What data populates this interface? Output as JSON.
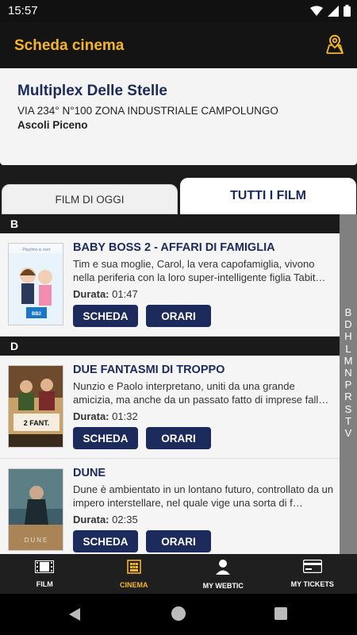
{
  "status": {
    "time": "15:57"
  },
  "appbar": {
    "title": "Scheda cinema"
  },
  "cinema": {
    "name": "Multiplex Delle Stelle",
    "address": "VIA 234° N°100 ZONA INDUSTRIALE CAMPOLUNGO",
    "city": "Ascoli Piceno"
  },
  "tabs": {
    "today": "FILM DI OGGI",
    "all": "TUTTI I FILM"
  },
  "sections": [
    {
      "letter": "B",
      "movies": [
        {
          "title": "BABY BOSS 2 - AFFARI DI FAMIGLIA",
          "plot": "Tim e sua moglie, Carol, la vera capofamiglia, vivono nella periferia con la loro super-intelligente figlia Tabit…",
          "duration_label": "Durata:",
          "duration": "01:47",
          "scheda": "SCHEDA",
          "orari": "ORARI"
        }
      ]
    },
    {
      "letter": "D",
      "movies": [
        {
          "title": "DUE FANTASMI DI TROPPO",
          "plot": "Nunzio e Paolo interpretano, uniti da una grande amicizia, ma anche da un passato fatto di imprese fall…",
          "duration_label": "Durata:",
          "duration": "01:32",
          "scheda": "SCHEDA",
          "orari": "ORARI"
        },
        {
          "title": "DUNE",
          "plot": "Dune è ambientato in un lontano futuro, controllato da un impero interstellare, nel quale vige una sorta di f…",
          "duration_label": "Durata:",
          "duration": "02:35",
          "scheda": "SCHEDA",
          "orari": "ORARI"
        }
      ]
    }
  ],
  "index_letters": [
    "B",
    "D",
    "H",
    "L",
    "M",
    "N",
    "P",
    "R",
    "S",
    "T",
    "V"
  ],
  "bottomnav": {
    "film": "FILM",
    "cinema": "CINEMA",
    "webtic": "MY WEBTIC",
    "tickets": "MY TICKETS"
  },
  "colors": {
    "accent": "#f5b52a",
    "primary": "#1c2a5c"
  }
}
